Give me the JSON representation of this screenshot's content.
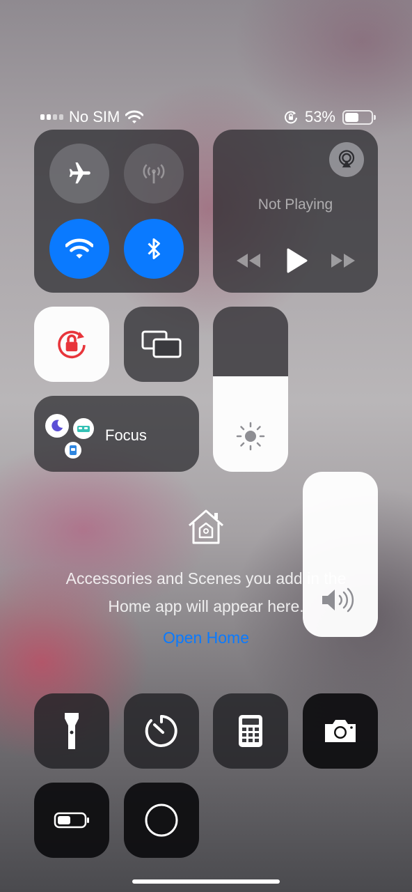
{
  "status_bar": {
    "carrier": "No SIM",
    "battery_percent_text": "53%",
    "battery_level": 0.53
  },
  "connectivity": {
    "airplane": {
      "icon": "airplane-icon",
      "state": "off"
    },
    "cellular": {
      "icon": "antenna-icon",
      "state": "disabled"
    },
    "wifi": {
      "icon": "wifi-icon",
      "state": "on"
    },
    "bluetooth": {
      "icon": "bluetooth-icon",
      "state": "on"
    }
  },
  "media": {
    "status": "Not Playing",
    "controls": [
      "rewind-icon",
      "play-icon",
      "fast-forward-icon"
    ],
    "airplay_icon": "airplay-icon"
  },
  "toggles": {
    "orientation_lock": {
      "icon": "orientation-lock-icon",
      "state": "on"
    },
    "screen_mirroring": {
      "icon": "screen-mirroring-icon"
    }
  },
  "focus": {
    "label": "Focus"
  },
  "sliders": {
    "brightness": {
      "level": 0.42,
      "icon": "sun-icon"
    },
    "volume": {
      "level": 1.0,
      "icon": "speaker-icon"
    }
  },
  "home": {
    "message_line1": "Accessories and Scenes you add in the",
    "message_line2": "Home app will appear here.",
    "link": "Open Home"
  },
  "shortcuts": [
    "flashlight-icon",
    "timer-icon",
    "calculator-icon",
    "camera-icon",
    "low-power-icon",
    "screen-record-icon"
  ],
  "colors": {
    "accent_blue": "#0a7aff",
    "lock_red": "#e8353b"
  }
}
